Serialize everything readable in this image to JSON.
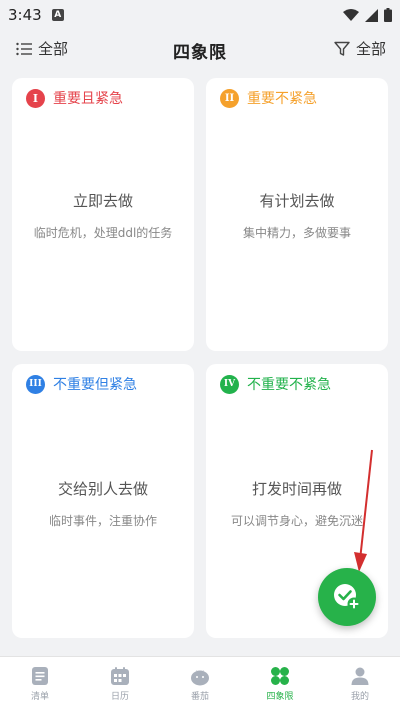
{
  "status": {
    "time": "3:43",
    "app_badge": "A"
  },
  "header": {
    "left_label": "全部",
    "title": "四象限",
    "right_label": "全部"
  },
  "quadrants": [
    {
      "numeral": "I",
      "title": "重要且紧急",
      "main": "立即去做",
      "sub": "临时危机，处理ddl的任务",
      "color": "#e5434b"
    },
    {
      "numeral": "II",
      "title": "重要不紧急",
      "main": "有计划去做",
      "sub": "集中精力，多做要事",
      "color": "#f5a12c"
    },
    {
      "numeral": "III",
      "title": "不重要但紧急",
      "main": "交给别人去做",
      "sub": "临时事件，注重协作",
      "color": "#2f80e4"
    },
    {
      "numeral": "IV",
      "title": "不重要不紧急",
      "main": "打发时间再做",
      "sub": "可以调节身心，避免沉迷",
      "color": "#22b24c"
    }
  ],
  "nav": [
    {
      "label": "清单",
      "icon": "list-icon"
    },
    {
      "label": "日历",
      "icon": "calendar-icon"
    },
    {
      "label": "番茄",
      "icon": "tomato-icon"
    },
    {
      "label": "四象限",
      "icon": "four-quadrant-icon",
      "active": true
    },
    {
      "label": "我的",
      "icon": "profile-icon"
    }
  ],
  "colors": {
    "accent": "#27b24a",
    "annotation_arrow": "#d32f2f"
  }
}
